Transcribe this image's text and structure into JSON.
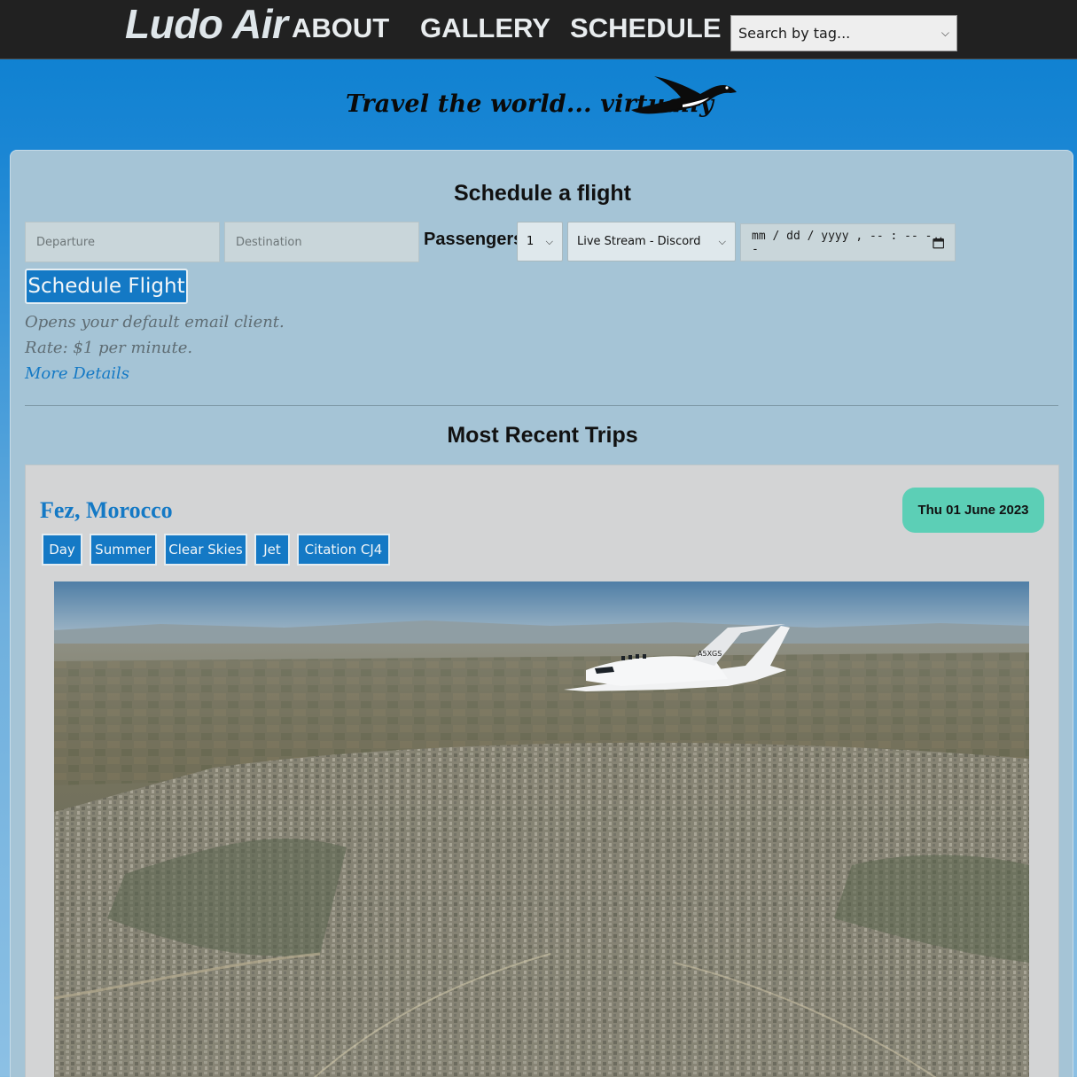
{
  "nav": {
    "brand": "Ludo Air",
    "links": [
      "ABOUT",
      "GALLERY",
      "SCHEDULE"
    ],
    "search_select": "Search by tag..."
  },
  "banner": {
    "slogan": "Travel the world... virtually"
  },
  "schedule": {
    "title": "Schedule a flight",
    "departure_placeholder": "Departure",
    "destination_placeholder": "Destination",
    "passengers_label": "Passengers:",
    "passengers_value": "1",
    "stream_value": "Live Stream - Discord",
    "datetime_placeholder": "mm / dd / yyyy ,  -- : --   --",
    "button": "Schedule Flight",
    "note_email": "Opens your default email client.",
    "note_rate": "Rate: $1 per minute.",
    "more_link": "More Details"
  },
  "recent": {
    "title": "Most Recent Trips",
    "trips": [
      {
        "title": "Fez, Morocco",
        "date": "Thu 01 June 2023",
        "tags": [
          "Day",
          "Summer",
          "Clear Skies",
          "Jet",
          "Citation CJ4"
        ],
        "registration": "A5XGS"
      }
    ]
  },
  "colors": {
    "nav_bg": "#212121",
    "accent": "#1479c5",
    "panel": "#a5c4d6",
    "badge": "#5ccfb6"
  }
}
